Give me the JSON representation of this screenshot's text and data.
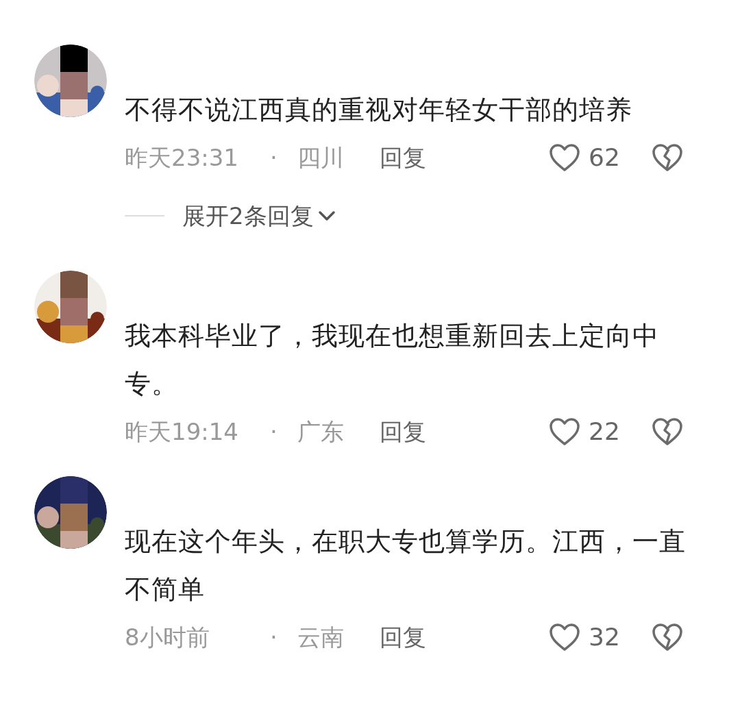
{
  "comments": [
    {
      "text": "不得不说江西真的重视对年轻女干部的培养",
      "time": "昨天23:31",
      "separator": "·",
      "region": "四川",
      "reply_label": "回复",
      "likes": "62",
      "expand_replies": "展开2条回复"
    },
    {
      "text": "我本科毕业了，我现在也想重新回去上定向中专。",
      "time": "昨天19:14",
      "separator": "·",
      "region": "广东",
      "reply_label": "回复",
      "likes": "22"
    },
    {
      "text": "现在这个年头，在职大专也算学历。江西，一直不简单",
      "time": "8小时前",
      "separator": "·",
      "region": "云南",
      "reply_label": "回复",
      "likes": "32"
    }
  ]
}
